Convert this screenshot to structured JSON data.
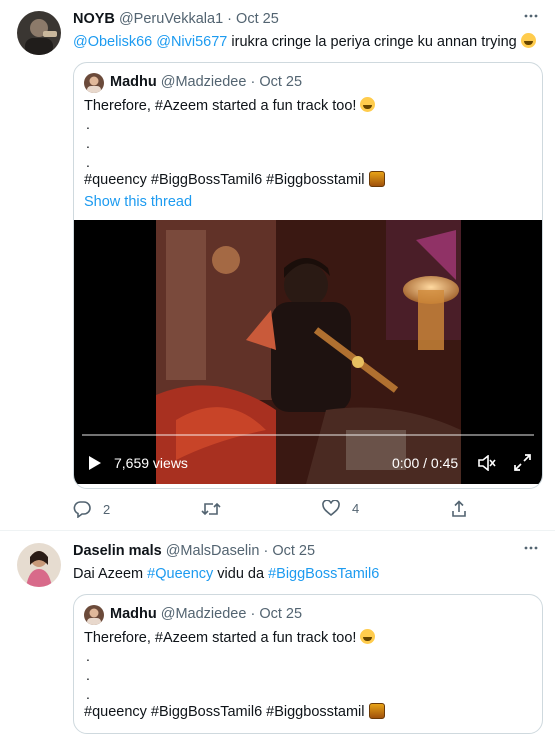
{
  "tweets": [
    {
      "author_name": "NOYB",
      "handle": "@PeruVekkala1",
      "sep": "·",
      "date": "Oct 25",
      "mention1": "@Obelisk66",
      "mention2": "@Nivi5677",
      "text": "irukra cringe la periya cringe ku annan trying",
      "quote": {
        "author_name": "Madhu",
        "handle": "@Madziedee",
        "sep": "·",
        "date": "Oct 25",
        "line1": "Therefore, #Azeem started a fun track too!",
        "dots": [
          ".",
          ".",
          "."
        ],
        "hashtags": "#queency #BiggBossTamil6 #Biggbosstamil",
        "show_thread": "Show this thread",
        "video": {
          "views": "7,659 views",
          "time": "0:00 / 0:45",
          "progress": 0
        }
      },
      "actions": {
        "reply_count": "2",
        "retweet_count": "",
        "like_count": "4"
      }
    },
    {
      "author_name": "Daselin mals",
      "handle": "@MalsDaselin",
      "sep": "·",
      "date": "Oct 25",
      "text_prefix": "Dai Azeem",
      "hashtag1": "#Queency",
      "text_mid": "vidu da",
      "hashtag2": "#BiggBossTamil6",
      "quote": {
        "author_name": "Madhu",
        "handle": "@Madziedee",
        "sep": "·",
        "date": "Oct 25",
        "line1": "Therefore, #Azeem started a fun track too!",
        "dots": [
          ".",
          ".",
          "."
        ],
        "hashtags": "#queency #BiggBossTamil6 #Biggbosstamil"
      }
    }
  ],
  "colors": {
    "accent": "#1d9bf0",
    "secondary_text": "#536471",
    "border": "#cfd9de"
  },
  "icons": [
    "more-icon",
    "reply-icon",
    "retweet-icon",
    "like-icon",
    "share-icon",
    "play-icon",
    "volume-icon",
    "fullscreen-icon",
    "laughing-emoji-icon",
    "bigg-boss-emoji-icon"
  ]
}
